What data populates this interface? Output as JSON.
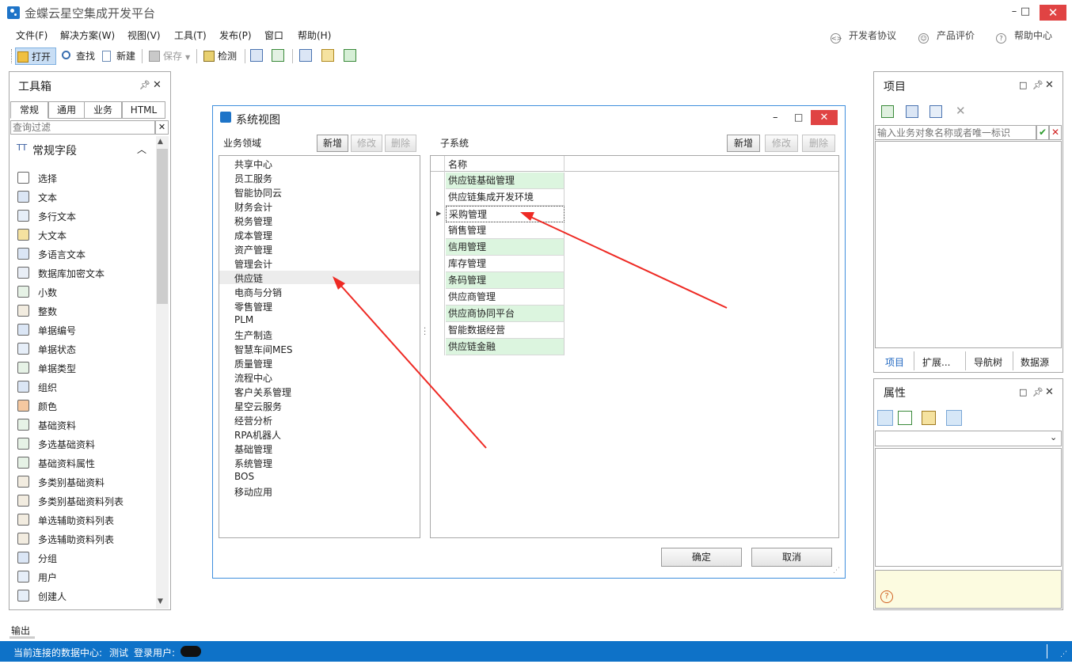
{
  "app": {
    "title": "金蝶云星空集成开发平台"
  },
  "window_controls": {
    "minimize": "–",
    "maximize": "□",
    "close": "✕"
  },
  "menu": {
    "items": [
      "文件(F)",
      "解决方案(W)",
      "视图(V)",
      "工具(T)",
      "发布(P)",
      "窗口",
      "帮助(H)"
    ],
    "right_links": [
      "开发者协议",
      "产品评价",
      "帮助中心"
    ]
  },
  "toolbar": {
    "open": "打开",
    "find": "查找",
    "new": "新建",
    "save": "保存",
    "check": "检测"
  },
  "toolbox": {
    "title": "工具箱",
    "tabs": [
      "常规",
      "通用",
      "业务",
      "HTML"
    ],
    "filter_placeholder": "查询过滤",
    "section": "常规字段",
    "items": [
      "选择",
      "文本",
      "多行文本",
      "大文本",
      "多语言文本",
      "数据库加密文本",
      "小数",
      "整数",
      "单据编号",
      "单据状态",
      "单据类型",
      "组织",
      "颜色",
      "基础资料",
      "多选基础资料",
      "基础资料属性",
      "多类别基础资料",
      "多类别基础资料列表",
      "单选辅助资料列表",
      "多选辅助资料列表",
      "分组",
      "用户",
      "创建人"
    ]
  },
  "output": {
    "label": "输出"
  },
  "dialog": {
    "title": "系统视图",
    "domain_label": "业务领域",
    "subsystem_label": "子系统",
    "btn_new": "新增",
    "btn_edit": "修改",
    "btn_delete": "删除",
    "domains": [
      "共享中心",
      "员工服务",
      "智能协同云",
      "财务会计",
      "税务管理",
      "成本管理",
      "资产管理",
      "管理会计",
      "供应链",
      "电商与分销",
      "零售管理",
      "PLM",
      "生产制造",
      "智慧车间MES",
      "质量管理",
      "流程中心",
      "客户关系管理",
      "星空云服务",
      "经营分析",
      "RPA机器人",
      "基础管理",
      "系统管理",
      "BOS",
      "移动应用"
    ],
    "selected_domain": "供应链",
    "grid_header": "名称",
    "subsystems": [
      "供应链基础管理",
      "供应链集成开发环境",
      "采购管理",
      "销售管理",
      "信用管理",
      "库存管理",
      "条码管理",
      "供应商管理",
      "供应商协同平台",
      "智能数据经营",
      "供应链金融"
    ],
    "selected_subsystem": "采购管理",
    "ok": "确定",
    "cancel": "取消"
  },
  "project_panel": {
    "title": "项目",
    "search_placeholder": "输入业务对象名称或者唯一标识",
    "tabs": [
      "项目",
      "扩展...",
      "导航树",
      "数据源"
    ]
  },
  "props_panel": {
    "title": "属性"
  },
  "status": {
    "datacenter_label": "当前连接的数据中心:",
    "datacenter_value": "测试",
    "user_label": "登录用户:"
  }
}
